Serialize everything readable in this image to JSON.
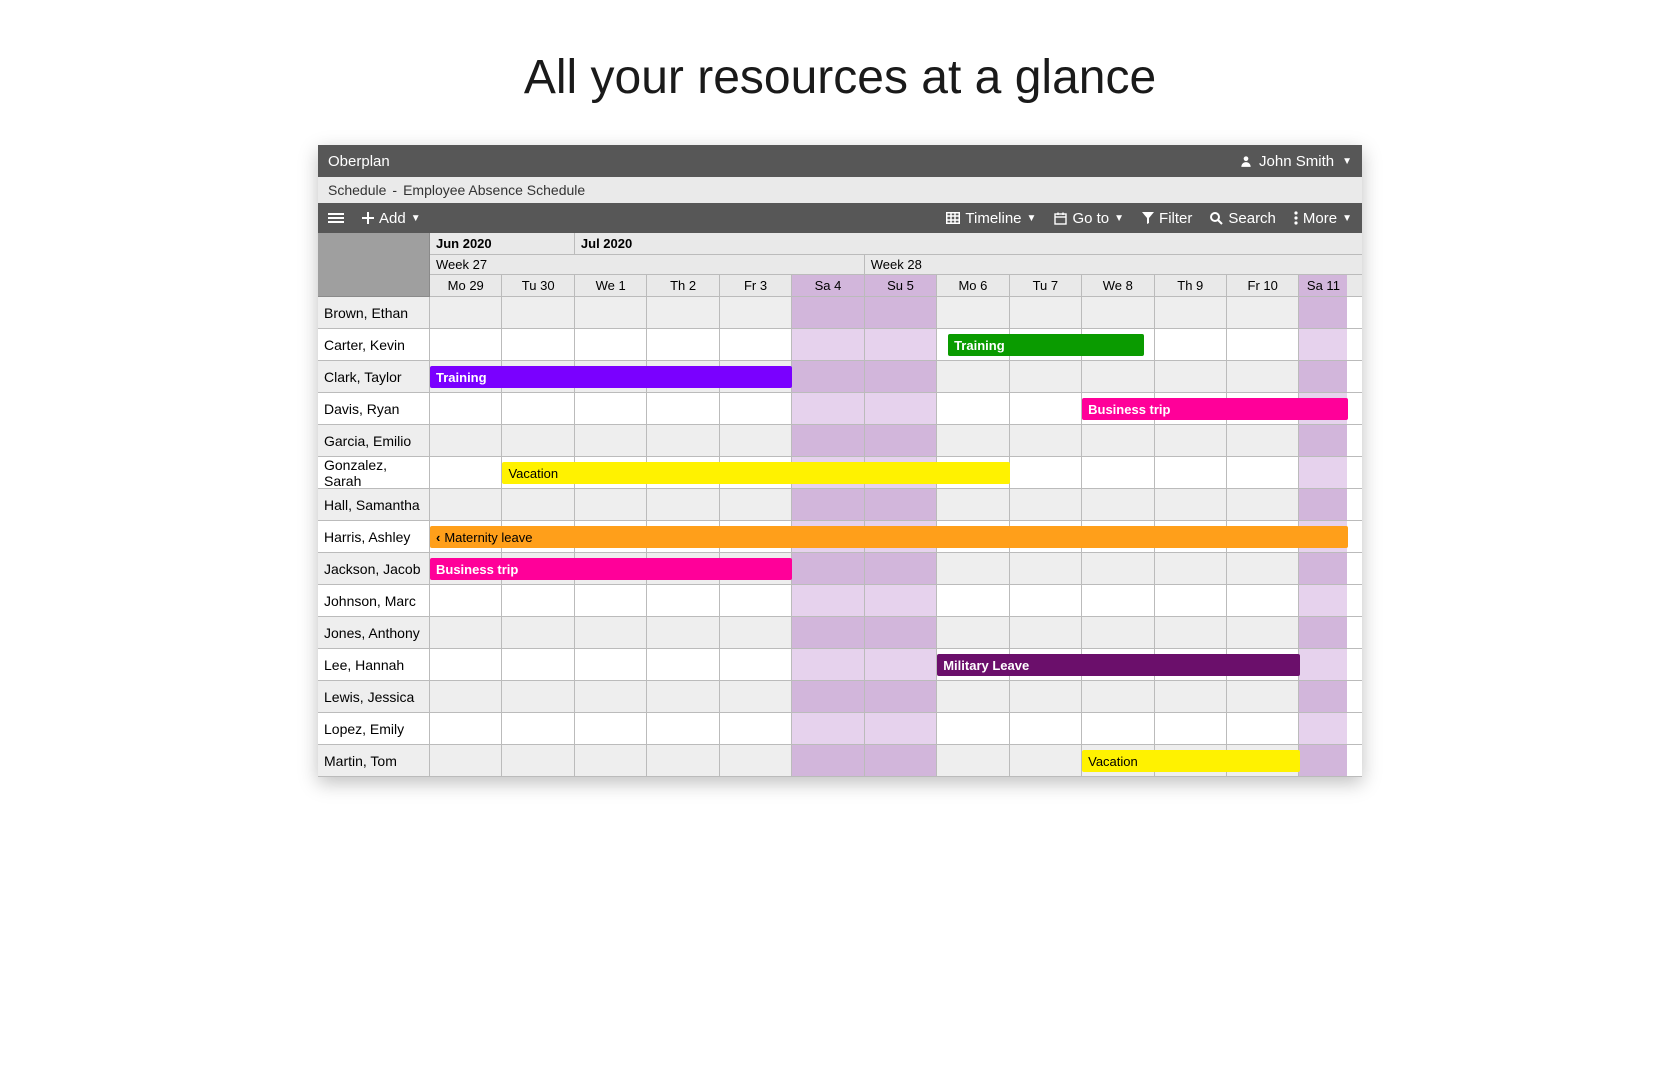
{
  "page_title": "All your resources at a glance",
  "brand": "Oberplan",
  "user_name": "John Smith",
  "breadcrumb": {
    "a": "Schedule",
    "b": "Employee Absence Schedule"
  },
  "tools": {
    "add": "Add",
    "timeline": "Timeline",
    "goto": "Go to",
    "filter": "Filter",
    "search": "Search",
    "more": "More"
  },
  "months": [
    {
      "label": "Jun 2020",
      "span_days": 2
    },
    {
      "label": "Jul 2020",
      "span_days": 11
    }
  ],
  "weeks": [
    {
      "label": "Week 27",
      "span_days": 6
    },
    {
      "label": "Week 28",
      "span_days": 7
    }
  ],
  "days": [
    {
      "label": "Mo 29",
      "weekend": false
    },
    {
      "label": "Tu 30",
      "weekend": false
    },
    {
      "label": "We 1",
      "weekend": false
    },
    {
      "label": "Th 2",
      "weekend": false
    },
    {
      "label": "Fr 3",
      "weekend": false
    },
    {
      "label": "Sa 4",
      "weekend": true
    },
    {
      "label": "Su 5",
      "weekend": true
    },
    {
      "label": "Mo 6",
      "weekend": false
    },
    {
      "label": "Tu 7",
      "weekend": false
    },
    {
      "label": "We 8",
      "weekend": false
    },
    {
      "label": "Th 9",
      "weekend": false
    },
    {
      "label": "Fr 10",
      "weekend": false
    },
    {
      "label": "Sa 11",
      "weekend": true
    }
  ],
  "resources": [
    {
      "name": "Brown, Ethan"
    },
    {
      "name": "Carter, Kevin",
      "events": [
        {
          "label": "Training",
          "start": 7.15,
          "end": 9.85,
          "color": "green"
        }
      ]
    },
    {
      "name": "Clark, Taylor",
      "events": [
        {
          "label": "Training",
          "start": 0,
          "end": 5,
          "color": "purple"
        }
      ]
    },
    {
      "name": "Davis, Ryan",
      "events": [
        {
          "label": "Business trip",
          "start": 9,
          "end": 13,
          "color": "pink"
        }
      ]
    },
    {
      "name": "Garcia, Emilio"
    },
    {
      "name": "Gonzalez, Sarah",
      "events": [
        {
          "label": "Vacation",
          "start": 1,
          "end": 8,
          "color": "yellow"
        }
      ]
    },
    {
      "name": "Hall, Samantha"
    },
    {
      "name": "Harris, Ashley",
      "events": [
        {
          "label": "Maternity leave",
          "start": 0,
          "end": 13,
          "color": "orange",
          "cont_left": true
        }
      ]
    },
    {
      "name": "Jackson, Jacob",
      "events": [
        {
          "label": "Business trip",
          "start": 0,
          "end": 5,
          "color": "pink"
        }
      ]
    },
    {
      "name": "Johnson, Marc"
    },
    {
      "name": "Jones, Anthony"
    },
    {
      "name": "Lee, Hannah",
      "events": [
        {
          "label": "Military Leave",
          "start": 7,
          "end": 12,
          "color": "maroon"
        }
      ]
    },
    {
      "name": "Lewis, Jessica"
    },
    {
      "name": "Lopez, Emily"
    },
    {
      "name": "Martin, Tom",
      "events": [
        {
          "label": "Vacation",
          "start": 9,
          "end": 12,
          "color": "yellow"
        }
      ]
    }
  ],
  "colors": {
    "green": "#0a9b00",
    "purple": "#7a00ff",
    "pink": "#ff0099",
    "yellow": "#fff200",
    "orange": "#ff9f1a",
    "maroon": "#6b0f6b"
  }
}
